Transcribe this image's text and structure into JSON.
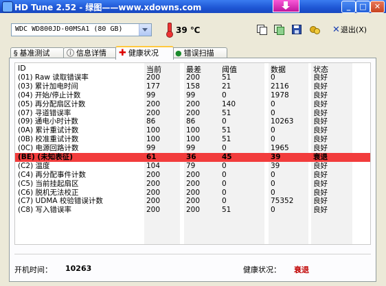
{
  "window": {
    "title": "HD Tune 2.52 - 绿图——www.xdowns.com",
    "minimize_label": "_",
    "maximize_label": "□",
    "close_label": "✕"
  },
  "toolbar": {
    "drive_value": "WDC WD800JD-00MSA1 (80 GB)",
    "temperature": "39 ℃",
    "exit_label": "退出(X)",
    "exit_icon": "x-icon"
  },
  "tabs": [
    {
      "label": "基准测试",
      "icon": "benchmark-icon"
    },
    {
      "label": "信息详情",
      "icon": "info-icon"
    },
    {
      "label": "健康状况",
      "icon": "health-cross-icon",
      "active": true
    },
    {
      "label": "错误扫描",
      "icon": "error-scan-icon"
    }
  ],
  "table": {
    "headers": {
      "id": "ID",
      "current": "当前",
      "worst": "最差",
      "threshold": "阈值",
      "data": "数据",
      "status": "状态"
    },
    "rows": [
      {
        "id": "(01) Raw 读取错误率",
        "current": "200",
        "worst": "200",
        "threshold": "51",
        "data": "0",
        "status": "良好"
      },
      {
        "id": "(03) 累计加电时间",
        "current": "177",
        "worst": "158",
        "threshold": "21",
        "data": "2116",
        "status": "良好"
      },
      {
        "id": "(04) 开始/停止计数",
        "current": "99",
        "worst": "99",
        "threshold": "0",
        "data": "1978",
        "status": "良好"
      },
      {
        "id": "(05) 再分配扇区计数",
        "current": "200",
        "worst": "200",
        "threshold": "140",
        "data": "0",
        "status": "良好"
      },
      {
        "id": "(07) 寻道错误率",
        "current": "200",
        "worst": "200",
        "threshold": "51",
        "data": "0",
        "status": "良好"
      },
      {
        "id": "(09) 通电小时计数",
        "current": "86",
        "worst": "86",
        "threshold": "0",
        "data": "10263",
        "status": "良好"
      },
      {
        "id": "(0A) 累计重试计数",
        "current": "100",
        "worst": "100",
        "threshold": "51",
        "data": "0",
        "status": "良好"
      },
      {
        "id": "(0B) 校准重试计数",
        "current": "100",
        "worst": "100",
        "threshold": "51",
        "data": "0",
        "status": "良好"
      },
      {
        "id": "(0C) 电源回路计数",
        "current": "99",
        "worst": "99",
        "threshold": "0",
        "data": "1965",
        "status": "良好"
      },
      {
        "id": "(BE) (未知表征)",
        "current": "61",
        "worst": "36",
        "threshold": "45",
        "data": "39",
        "status": "衰退",
        "failing": true
      },
      {
        "id": "(C2) 温度",
        "current": "104",
        "worst": "79",
        "threshold": "0",
        "data": "39",
        "status": "良好"
      },
      {
        "id": "(C4) 再分配事件计数",
        "current": "200",
        "worst": "200",
        "threshold": "0",
        "data": "0",
        "status": "良好"
      },
      {
        "id": "(C5) 当前挂起扇区",
        "current": "200",
        "worst": "200",
        "threshold": "0",
        "data": "0",
        "status": "良好"
      },
      {
        "id": "(C6) 脱机无法校正",
        "current": "200",
        "worst": "200",
        "threshold": "0",
        "data": "0",
        "status": "良好"
      },
      {
        "id": "(C7) UDMA 校验错误计数",
        "current": "200",
        "worst": "200",
        "threshold": "0",
        "data": "75352",
        "status": "良好"
      },
      {
        "id": "(C8) 写入错误率",
        "current": "200",
        "worst": "200",
        "threshold": "51",
        "data": "0",
        "status": "良好"
      }
    ]
  },
  "footer": {
    "power_on_label": "开机时间：",
    "power_on_value": "10263",
    "health_label": "健康状况：",
    "health_value": "衰退"
  },
  "colors": {
    "failing_row": "#f23c3c",
    "health_bad": "#c00000",
    "titlebar": "#1e56d4"
  }
}
